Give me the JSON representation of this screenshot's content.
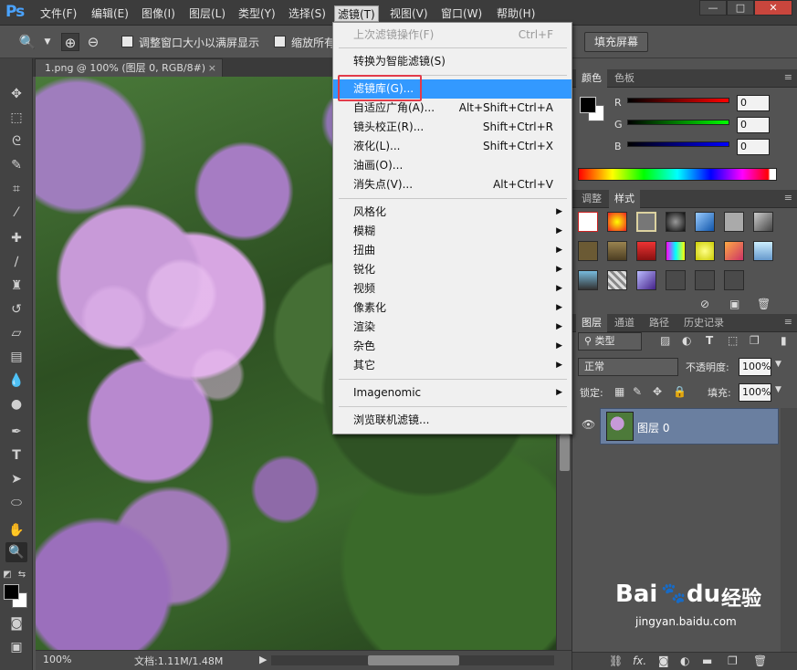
{
  "app": {
    "logo": "Ps"
  },
  "menubar": {
    "items": [
      "文件(F)",
      "编辑(E)",
      "图像(I)",
      "图层(L)",
      "类型(Y)",
      "选择(S)",
      "滤镜(T)",
      "视图(V)",
      "窗口(W)",
      "帮助(H)"
    ],
    "active_index": 6,
    "window_controls": [
      "—",
      "□",
      "✕"
    ]
  },
  "options_bar": {
    "resize_windows_label": "调整窗口大小以满屏显示",
    "zoom_all_label": "缩放所有",
    "fill_screen_button": "填充屏幕"
  },
  "document": {
    "tab_title": "1.png @ 100% (图层 0, RGB/8#)",
    "tab_close": "×",
    "zoom": "100%",
    "doc_info": "文档:1.11M/1.48M"
  },
  "filter_menu": {
    "last_filter": {
      "label": "上次滤镜操作(F)",
      "shortcut": "Ctrl+F"
    },
    "convert_smart": "转换为智能滤镜(S)",
    "group_main": [
      {
        "label": "滤镜库(G)...",
        "shortcut": "",
        "highlighted": true
      },
      {
        "label": "自适应广角(A)...",
        "shortcut": "Alt+Shift+Ctrl+A"
      },
      {
        "label": "镜头校正(R)...",
        "shortcut": "Shift+Ctrl+R"
      },
      {
        "label": "液化(L)...",
        "shortcut": "Shift+Ctrl+X"
      },
      {
        "label": "油画(O)...",
        "shortcut": ""
      },
      {
        "label": "消失点(V)...",
        "shortcut": "Alt+Ctrl+V"
      }
    ],
    "submenus": [
      "风格化",
      "模糊",
      "扭曲",
      "锐化",
      "视频",
      "像素化",
      "渲染",
      "杂色",
      "其它"
    ],
    "plugin": "Imagenomic",
    "browse_online": "浏览联机滤镜..."
  },
  "color_panel": {
    "tabs": [
      "颜色",
      "色板"
    ],
    "channels": [
      {
        "label": "R",
        "value": "0",
        "color": "#cc2020"
      },
      {
        "label": "G",
        "value": "0",
        "color": "#20b020"
      },
      {
        "label": "B",
        "value": "0",
        "color": "#2040d0"
      }
    ]
  },
  "styles_panel": {
    "tabs": [
      "调整",
      "样式"
    ],
    "active": 1
  },
  "layers_panel": {
    "tabs": [
      "图层",
      "通道",
      "路径",
      "历史记录"
    ],
    "filter_kind": "类型",
    "blend_mode": "正常",
    "opacity_label": "不透明度:",
    "opacity_value": "100%",
    "lock_label": "锁定:",
    "fill_label": "填充:",
    "fill_value": "100%",
    "layers": [
      {
        "name": "图层 0"
      }
    ],
    "footer_icons": [
      "link-icon",
      "fx-icon",
      "mask-icon",
      "adjustment-icon",
      "group-icon",
      "new-layer-icon",
      "trash-icon"
    ]
  },
  "watermark": {
    "brand": "Bai",
    "brand2": "du",
    "cn": "经验",
    "url": "jingyan.baidu.com"
  }
}
